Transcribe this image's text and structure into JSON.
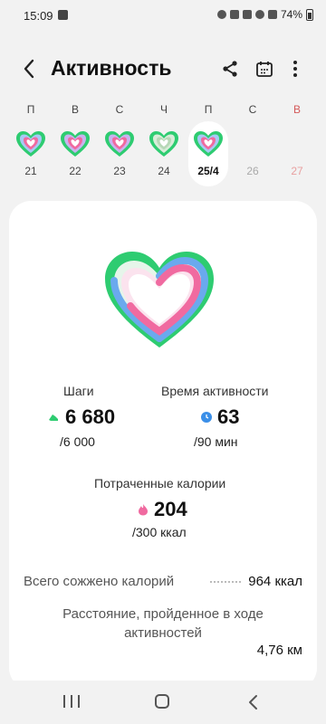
{
  "status_bar": {
    "time": "15:09",
    "battery": "74%"
  },
  "header": {
    "title": "Активность"
  },
  "week": {
    "days": [
      {
        "letter": "П",
        "number": "21"
      },
      {
        "letter": "В",
        "number": "22"
      },
      {
        "letter": "С",
        "number": "23"
      },
      {
        "letter": "Ч",
        "number": "24"
      },
      {
        "letter": "П",
        "number": "25/4"
      },
      {
        "letter": "С",
        "number": "26"
      },
      {
        "letter": "В",
        "number": "27"
      }
    ]
  },
  "metrics": {
    "steps": {
      "label": "Шаги",
      "value": "6 680",
      "goal": "/6 000"
    },
    "active_time": {
      "label": "Время активности",
      "value": "63",
      "goal": "/90 мин"
    },
    "calories": {
      "label": "Потраченные калории",
      "value": "204",
      "goal": "/300 ккал"
    }
  },
  "summary": {
    "total_calories_label": "Всего сожжено калорий",
    "total_calories_value": "964 ккал",
    "distance_label": "Расстояние, пройденное в ходе активностей",
    "distance_value": "4,76 км"
  },
  "colors": {
    "green": "#2ecc71",
    "blue": "#6aa9ee",
    "pink": "#f06aa0",
    "accent_sunday": "#d45a5a"
  }
}
